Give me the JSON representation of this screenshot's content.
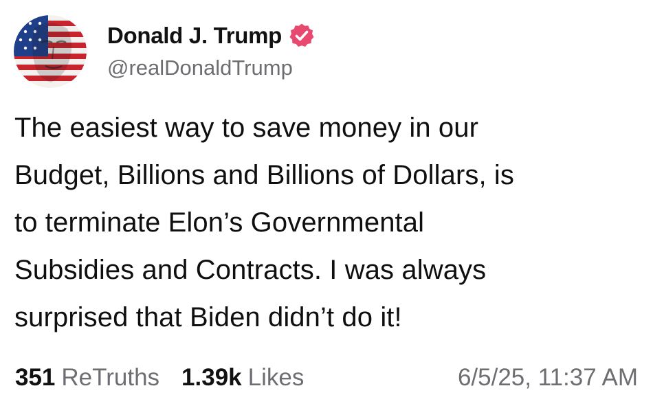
{
  "author": {
    "display_name": "Donald J. Trump",
    "handle": "@realDonaldTrump",
    "avatar_icon": "flag-portrait-avatar",
    "verified_icon": "verified-badge-icon",
    "verified_color": "#e8496e"
  },
  "post": {
    "text_lines": [
      "The easiest way to save money in our",
      "Budget, Billions and Billions of Dollars, is",
      "to terminate Elon’s Governmental",
      "Subsidies and Contracts. I was always",
      "surprised that Biden didn’t do it!"
    ]
  },
  "stats": {
    "retruths_count": "351",
    "retruths_label": "ReTruths",
    "likes_count": "1.39k",
    "likes_label": "Likes",
    "timestamp": "6/5/25, 11:37 AM"
  }
}
